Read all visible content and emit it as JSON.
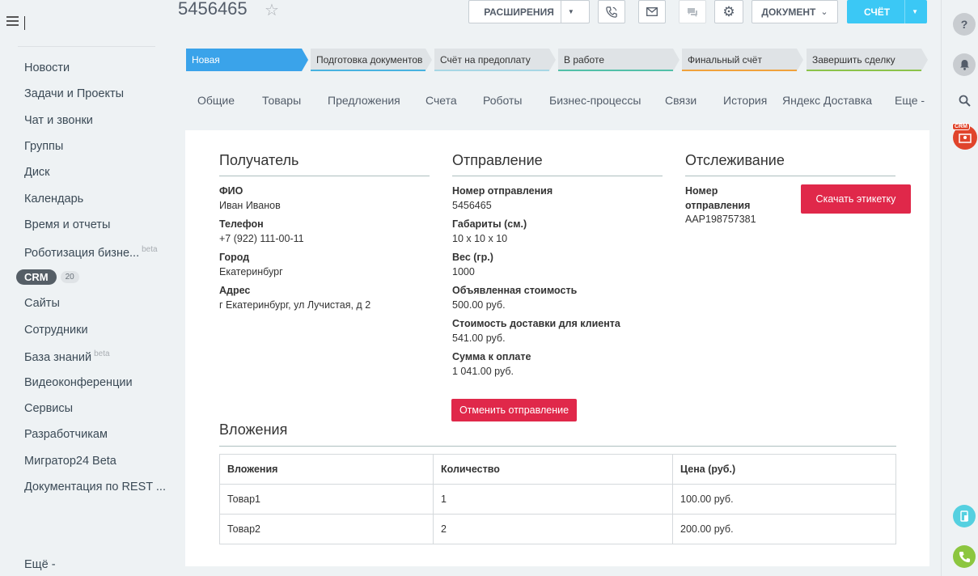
{
  "deal": {
    "number": "5456465"
  },
  "toolbar": {
    "extensions": "РАСШИРЕНИЯ",
    "document": "ДОКУМЕНТ",
    "invoice": "СЧЁТ"
  },
  "stages": [
    {
      "label": "Новая",
      "color": "#3aa3ea",
      "text_color": "#ffffff"
    },
    {
      "label": "Подготовка документов",
      "color": "#47b2e0"
    },
    {
      "label": "Счёт на предоплату",
      "color": "#a7d7e5"
    },
    {
      "label": "В работе",
      "color": "#52c0a8"
    },
    {
      "label": "Финальный счёт",
      "color": "#f0a23c"
    },
    {
      "label": "Завершить сделку",
      "color": "#8bc34a"
    }
  ],
  "tabs": [
    "Общие",
    "Товары",
    "Предложения",
    "Счета",
    "Роботы",
    "Бизнес-процессы",
    "Связи",
    "История",
    "Яндекс Доставка",
    "Еще -"
  ],
  "sidebar": {
    "items": [
      {
        "label": "Новости"
      },
      {
        "label": "Задачи и Проекты"
      },
      {
        "label": "Чат и звонки"
      },
      {
        "label": "Группы"
      },
      {
        "label": "Диск"
      },
      {
        "label": "Календарь"
      },
      {
        "label": "Время и отчеты"
      },
      {
        "label": "Роботизация бизне...",
        "badge": "beta"
      },
      {
        "label": "CRM",
        "count": "20"
      },
      {
        "label": "Сайты"
      },
      {
        "label": "Сотрудники"
      },
      {
        "label": "База знаний",
        "badge": "beta"
      },
      {
        "label": "Видеоконференции"
      },
      {
        "label": "Сервисы"
      },
      {
        "label": "Разработчикам"
      },
      {
        "label": "Мигратор24 Beta"
      },
      {
        "label": "Документация по REST ..."
      }
    ],
    "more": "Ещё -"
  },
  "recipient": {
    "title": "Получатель",
    "fields": [
      {
        "label": "ФИО",
        "value": "Иван Иванов"
      },
      {
        "label": "Телефон",
        "value": "+7 (922) 111-00-11"
      },
      {
        "label": "Город",
        "value": "Екатеринбург"
      },
      {
        "label": "Адрес",
        "value": "г Екатеринбург, ул Лучистая, д 2"
      }
    ]
  },
  "shipment": {
    "title": "Отправление",
    "fields": [
      {
        "label": "Номер отправления",
        "value": "5456465"
      },
      {
        "label": "Габариты (см.)",
        "value": "10 x 10 x 10"
      },
      {
        "label": "Вес (гр.)",
        "value": "1000"
      },
      {
        "label": "Объявленная стоимость",
        "value": "500.00 руб."
      },
      {
        "label": "Стоимость доставки для клиента",
        "value": "541.00 руб."
      },
      {
        "label": "Сумма к оплате",
        "value": "1 041.00 руб."
      }
    ],
    "cancel_button": "Отменить отправление"
  },
  "tracking": {
    "title": "Отслеживание",
    "label_line1": "Номер",
    "label_line2": "отправления",
    "value": "AAP198757381",
    "download_button": "Скачать этикетку"
  },
  "attachments": {
    "title": "Вложения",
    "columns": [
      "Вложения",
      "Количество",
      "Цена (руб.)"
    ],
    "rows": [
      [
        "Товар1",
        "1",
        "100.00 руб."
      ],
      [
        "Товар2",
        "2",
        "200.00 руб."
      ]
    ]
  },
  "colors": {
    "accent": "#3bc8f5",
    "danger": "#e0284a",
    "crm_badge": "#e0442b",
    "call": "#8cc63f",
    "rail_teal": "#55d0e0"
  }
}
